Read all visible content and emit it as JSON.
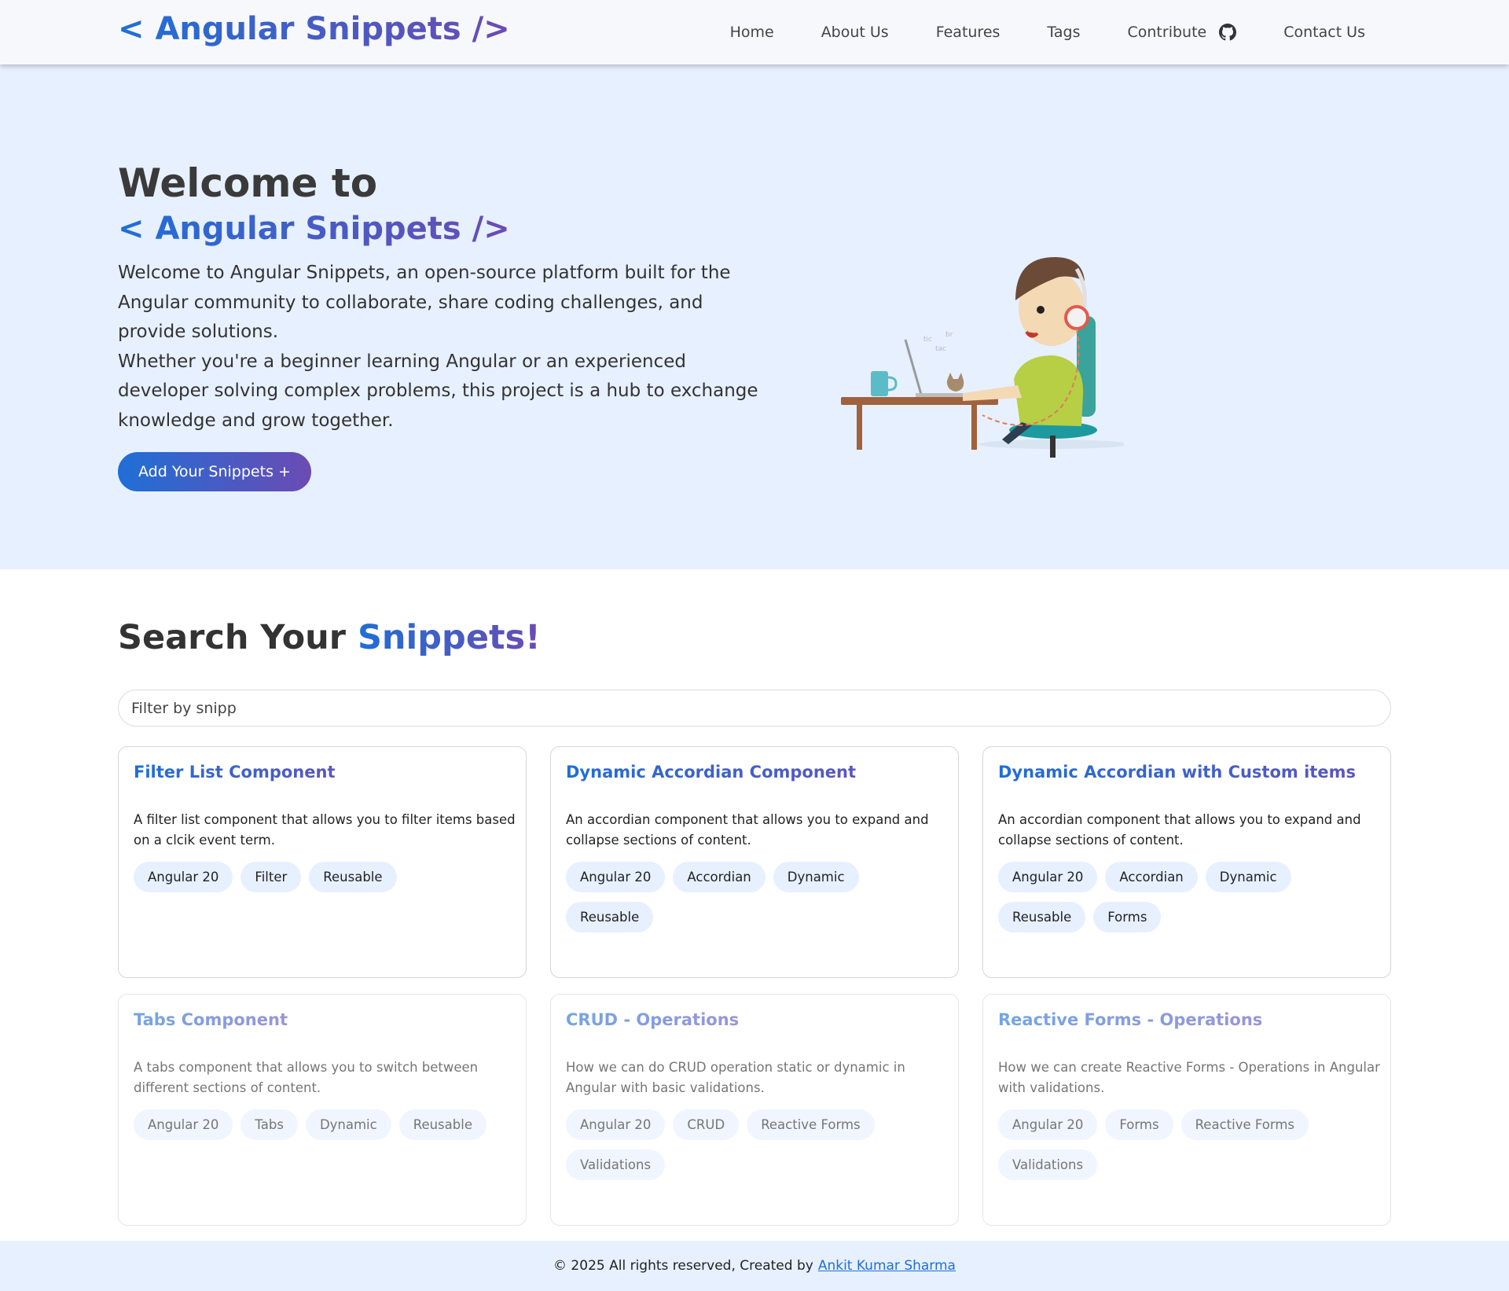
{
  "header": {
    "brand": "< Angular Snippets />",
    "nav": [
      {
        "label": "Home"
      },
      {
        "label": "About Us"
      },
      {
        "label": "Features"
      },
      {
        "label": "Tags"
      },
      {
        "label": "Contribute",
        "icon": "github-icon"
      },
      {
        "label": "Contact Us"
      }
    ]
  },
  "hero": {
    "title": "Welcome to",
    "brand": "< Angular Snippets />",
    "paragraph1": "Welcome to Angular Snippets, an open-source platform built for the Angular community to collaborate, share coding challenges, and provide solutions.",
    "paragraph2": "Whether you're a beginner learning Angular or an experienced developer solving complex problems, this project is a hub to exchange knowledge and grow together.",
    "cta_label": "Add Your Snippets +",
    "illustration_icon": "developer-at-desk-illustration"
  },
  "search": {
    "title_prefix": "Search Your ",
    "title_highlight": "Snippets!",
    "input_value": "Filter by snipp"
  },
  "cards": [
    {
      "title": "Filter List Component",
      "description": "A filter list component that allows you to filter items based on a clcik event term.",
      "tags": [
        "Angular 20",
        "Filter",
        "Reusable"
      ]
    },
    {
      "title": "Dynamic Accordian Component",
      "description": "An accordian component that allows you to expand and collapse sections of content.",
      "tags": [
        "Angular 20",
        "Accordian",
        "Dynamic",
        "Reusable"
      ]
    },
    {
      "title": "Dynamic Accordian with Custom items",
      "description": "An accordian component that allows you to expand and collapse sections of content.",
      "tags": [
        "Angular 20",
        "Accordian",
        "Dynamic",
        "Reusable",
        "Forms"
      ]
    },
    {
      "title": "Tabs Component",
      "description": "A tabs component that allows you to switch between different sections of content.",
      "tags": [
        "Angular 20",
        "Tabs",
        "Dynamic",
        "Reusable"
      ]
    },
    {
      "title": "CRUD - Operations",
      "description": "How we can do CRUD operation static or dynamic in Angular with basic validations.",
      "tags": [
        "Angular 20",
        "CRUD",
        "Reactive Forms",
        "Validations"
      ]
    },
    {
      "title": "Reactive Forms - Operations",
      "description": "How we can create Reactive Forms - Operations in Angular with validations.",
      "tags": [
        "Angular 20",
        "Forms",
        "Reactive Forms",
        "Validations"
      ]
    }
  ],
  "footer": {
    "text": "© 2025 All rights reserved, Created by",
    "author": "Ankit Kumar Sharma"
  },
  "colors": {
    "brand_start": "#1f6fd6",
    "brand_end": "#6b4bb3",
    "hero_bg": "#e7f0ff",
    "tag_bg": "#e7f0ff"
  }
}
